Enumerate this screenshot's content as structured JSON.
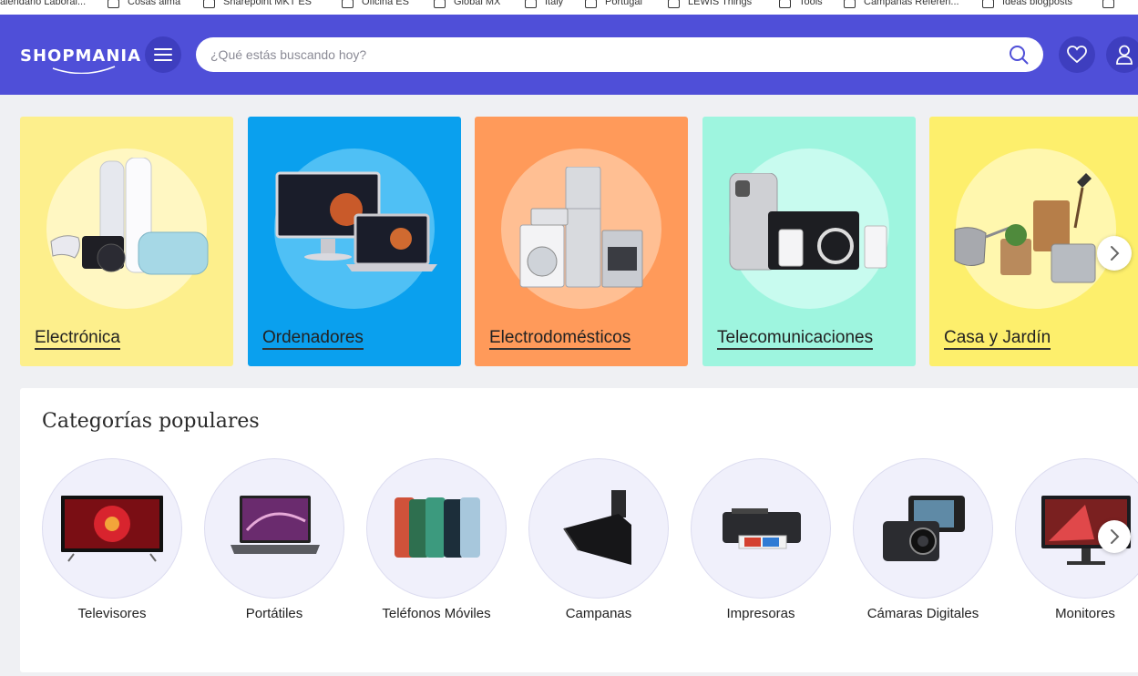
{
  "bookmarks": [
    "Calendario Laboral...",
    "Cosas almá",
    "Sharepoint MKT ES",
    "Oficina ES",
    "Global MX",
    "Italy",
    "Portugal",
    "LEWIS Things",
    "Tools",
    "Campañas Referen...",
    "Ideas blogposts"
  ],
  "header": {
    "logo_text": "SHOPMANIA",
    "search_placeholder": "¿Qué estás buscando hoy?",
    "brand_color": "#4f4fd8"
  },
  "cards": [
    {
      "label": "Electrónica",
      "bg": "#fdef8c",
      "circle": "#fff7c2"
    },
    {
      "label": "Ordenadores",
      "bg": "#0aa0ee",
      "circle": "#4fc0f5"
    },
    {
      "label": "Electrodomésticos",
      "bg": "#ff9a5a",
      "circle": "#ffbf93"
    },
    {
      "label": "Telecomunicaciones",
      "bg": "#9ef5df",
      "circle": "#c8fbef"
    },
    {
      "label": "Casa y Jardín",
      "bg": "#fdef6c",
      "circle": "#fff7ae"
    }
  ],
  "popular": {
    "title": "Categorías populares",
    "items": [
      {
        "label": "Televisores",
        "icon": "tv-icon"
      },
      {
        "label": "Portátiles",
        "icon": "laptop-icon"
      },
      {
        "label": "Teléfonos Móviles",
        "icon": "phone-icon"
      },
      {
        "label": "Campanas",
        "icon": "range-hood-icon"
      },
      {
        "label": "Impresoras",
        "icon": "printer-icon"
      },
      {
        "label": "Cámaras Digitales",
        "icon": "camera-icon"
      },
      {
        "label": "Monitores",
        "icon": "monitor-icon"
      }
    ]
  }
}
